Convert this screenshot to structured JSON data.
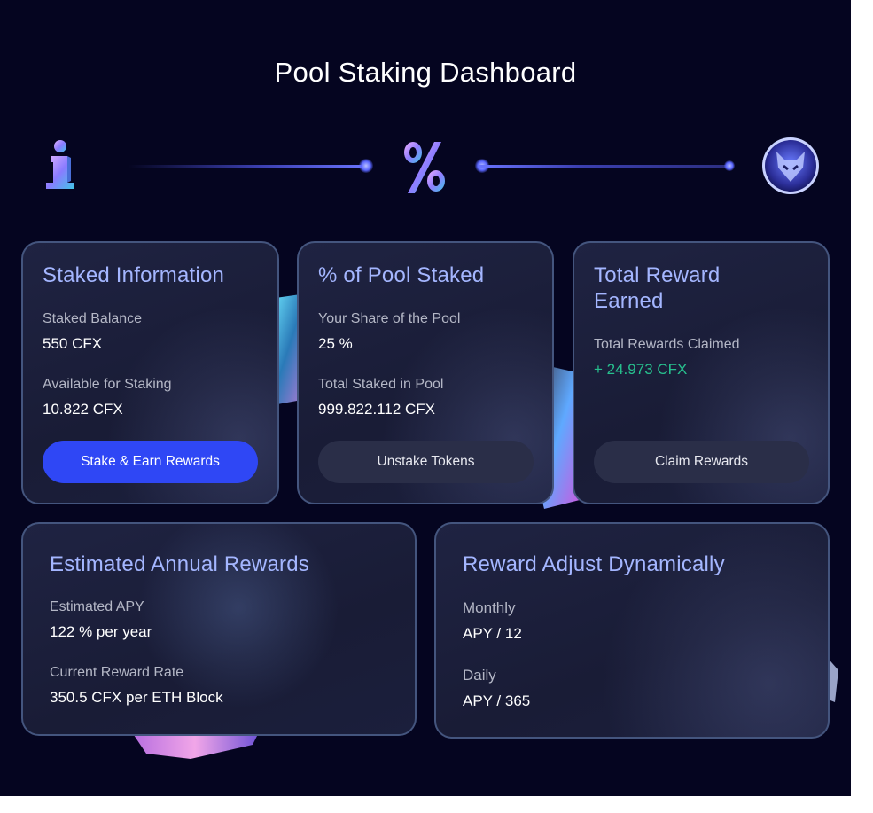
{
  "page": {
    "title": "Pool Staking Dashboard"
  },
  "steps": {
    "icons": [
      "info-icon",
      "percent-icon",
      "fox-badge-icon"
    ]
  },
  "colors": {
    "background": "#050520",
    "accent": "#2f47f5",
    "card_title": "#a4b6ff",
    "positive": "#27c08e"
  },
  "staked_info": {
    "title": "Staked Information",
    "balance_label": "Staked Balance",
    "balance_value": "550 CFX",
    "available_label": "Available for Staking",
    "available_value": "10.822 CFX",
    "button": "Stake & Earn Rewards"
  },
  "pool_share": {
    "title": "% of Pool Staked",
    "share_label": "Your Share of the Pool",
    "share_value": "25 %",
    "total_label": "Total Staked in Pool",
    "total_value": "999.822.112 CFX",
    "button": "Unstake Tokens"
  },
  "rewards": {
    "title": "Total Reward Earned",
    "claimed_label": "Total Rewards Claimed",
    "claimed_value": "+ 24.973 CFX",
    "button": "Claim Rewards"
  },
  "annual": {
    "title": "Estimated Annual Rewards",
    "apy_label": "Estimated APY",
    "apy_value": "122 % per year",
    "rate_label": "Current Reward Rate",
    "rate_value": "350.5 CFX per ETH Block"
  },
  "dynamic": {
    "title": "Reward Adjust Dynamically",
    "monthly_label": "Monthly",
    "monthly_value": "APY / 12",
    "daily_label": "Daily",
    "daily_value": "APY / 365"
  }
}
